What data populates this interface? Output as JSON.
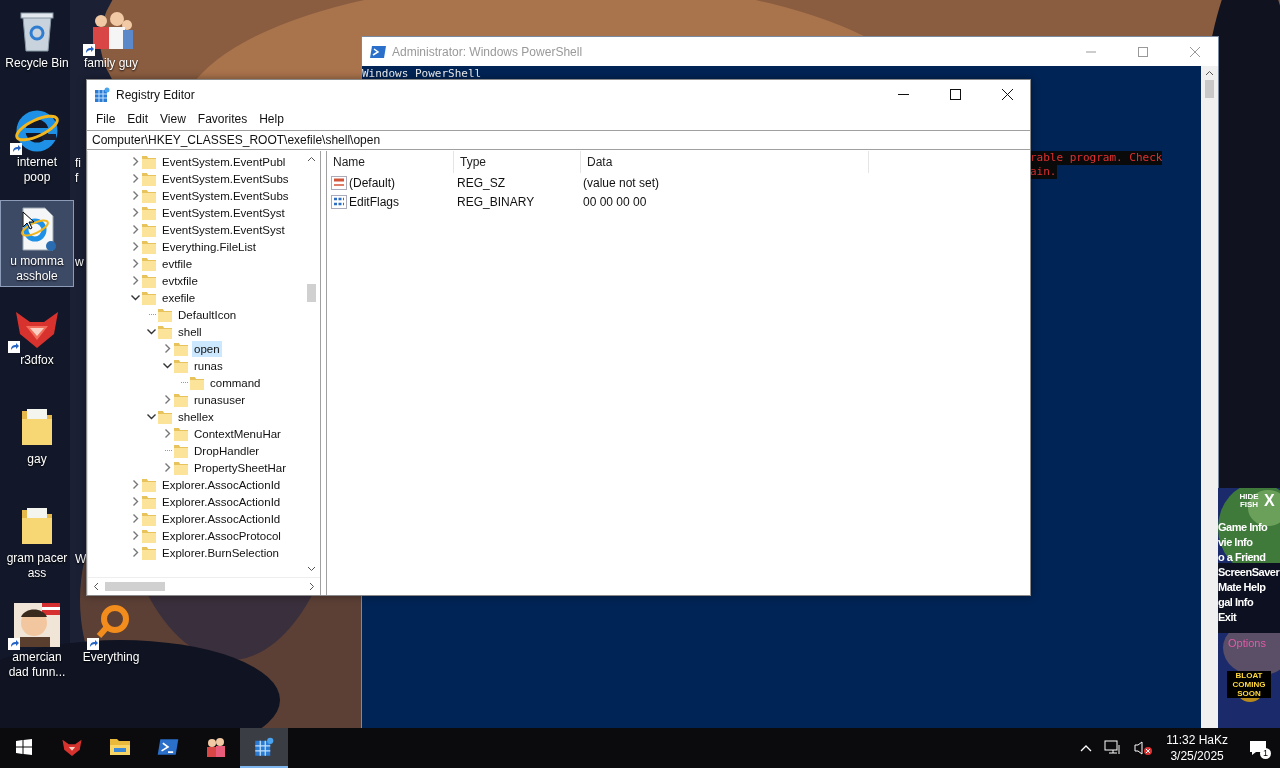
{
  "desktop": {
    "column_1": [
      {
        "label": "Recycle Bin",
        "kind": "recycle-bin",
        "shortcut": false,
        "selected": false
      },
      {
        "label": "internet poop",
        "kind": "browser",
        "shortcut": true,
        "selected": false
      },
      {
        "label": "u momma asshole",
        "kind": "web-document",
        "shortcut": false,
        "selected": true
      },
      {
        "label": "r3dfox",
        "kind": "fox",
        "shortcut": true,
        "selected": false
      },
      {
        "label": "gay",
        "kind": "folder",
        "shortcut": false,
        "selected": false
      },
      {
        "label": "gram pacer ass",
        "kind": "folder",
        "shortcut": false,
        "selected": false
      },
      {
        "label": "amercian dad funn...",
        "kind": "cartoon",
        "shortcut": true,
        "selected": false
      }
    ],
    "column_2": [
      {
        "label": "family guy",
        "kind": "group",
        "shortcut": true,
        "selected": false
      },
      {
        "label": "fi f",
        "kind": "hidden"
      },
      {
        "label": "w",
        "kind": "hidden"
      },
      {
        "label": "W",
        "kind": "hidden"
      },
      {
        "label": "Everything",
        "kind": "search",
        "shortcut": true,
        "selected": false
      }
    ]
  },
  "powershell": {
    "title": "Administrator: Windows PowerShell",
    "lines": [
      "Windows PowerShell"
    ],
    "error_lines": [
      "rable program. Check",
      "ain."
    ]
  },
  "registry": {
    "title": "Registry Editor",
    "menu": [
      "File",
      "Edit",
      "View",
      "Favorites",
      "Help"
    ],
    "address": "Computer\\HKEY_CLASSES_ROOT\\exefile\\shell\\open",
    "tree": [
      {
        "label": "EventSystem.EventPubl",
        "kind": "branch",
        "expanded": false,
        "selected": false
      },
      {
        "label": "EventSystem.EventSubs",
        "kind": "branch",
        "expanded": false,
        "selected": false
      },
      {
        "label": "EventSystem.EventSubs",
        "kind": "branch",
        "expanded": false,
        "selected": false
      },
      {
        "label": "EventSystem.EventSyst",
        "kind": "branch",
        "expanded": false,
        "selected": false
      },
      {
        "label": "EventSystem.EventSyst",
        "kind": "branch",
        "expanded": false,
        "selected": false
      },
      {
        "label": "Everything.FileList",
        "kind": "branch",
        "expanded": false,
        "selected": false
      },
      {
        "label": "evtfile",
        "kind": "branch",
        "expanded": false,
        "selected": false
      },
      {
        "label": "evtxfile",
        "kind": "branch",
        "expanded": false,
        "selected": false
      },
      {
        "label": "exefile",
        "kind": "branch",
        "expanded": true,
        "selected": false,
        "children": [
          {
            "label": "DefaultIcon",
            "kind": "leaf",
            "selected": false
          },
          {
            "label": "shell",
            "kind": "branch",
            "expanded": true,
            "selected": false,
            "children": [
              {
                "label": "open",
                "kind": "branch",
                "expanded": false,
                "selected": true
              },
              {
                "label": "runas",
                "kind": "branch",
                "expanded": true,
                "selected": false,
                "children": [
                  {
                    "label": "command",
                    "kind": "leaf",
                    "selected": false
                  }
                ]
              },
              {
                "label": "runasuser",
                "kind": "branch",
                "expanded": false,
                "selected": false
              }
            ]
          },
          {
            "label": "shellex",
            "kind": "branch",
            "expanded": true,
            "selected": false,
            "children": [
              {
                "label": "ContextMenuHar",
                "kind": "branch",
                "expanded": false,
                "selected": false
              },
              {
                "label": "DropHandler",
                "kind": "leaf",
                "selected": false
              },
              {
                "label": "PropertySheetHar",
                "kind": "branch",
                "expanded": false,
                "selected": false
              }
            ]
          }
        ]
      },
      {
        "label": "Explorer.AssocActionId",
        "kind": "branch",
        "expanded": false,
        "selected": false
      },
      {
        "label": "Explorer.AssocActionId",
        "kind": "branch",
        "expanded": false,
        "selected": false
      },
      {
        "label": "Explorer.AssocActionId",
        "kind": "branch",
        "expanded": false,
        "selected": false
      },
      {
        "label": "Explorer.AssocProtocol",
        "kind": "branch",
        "expanded": false,
        "selected": false
      },
      {
        "label": "Explorer.BurnSelection",
        "kind": "branch",
        "expanded": false,
        "selected": false
      }
    ],
    "columns": [
      "Name",
      "Type",
      "Data"
    ],
    "values": [
      {
        "name": "(Default)",
        "kind": "string",
        "type": "REG_SZ",
        "data": "(value not set)"
      },
      {
        "name": "EditFlags",
        "kind": "binary",
        "type": "REG_BINARY",
        "data": "00 00 00 00"
      }
    ]
  },
  "fish_panel": {
    "hide_label": "HIDE FISH",
    "close": "X",
    "menu": [
      "Game Info",
      "vie Info",
      "o a Friend",
      "ScreenSaver",
      "Mate Help",
      "gal Info",
      "Exit"
    ],
    "options": "Options",
    "banner": "BLOAT COMING SOON"
  },
  "taskbar": {
    "apps": [
      {
        "kind": "fox",
        "selected": false
      },
      {
        "kind": "folder",
        "selected": false
      },
      {
        "kind": "terminal",
        "selected": false
      },
      {
        "kind": "cartoon",
        "selected": false
      },
      {
        "kind": "registry",
        "selected": true
      }
    ],
    "time": "11:32 HaKz",
    "date": "3/25/2025",
    "notifications": "1"
  }
}
